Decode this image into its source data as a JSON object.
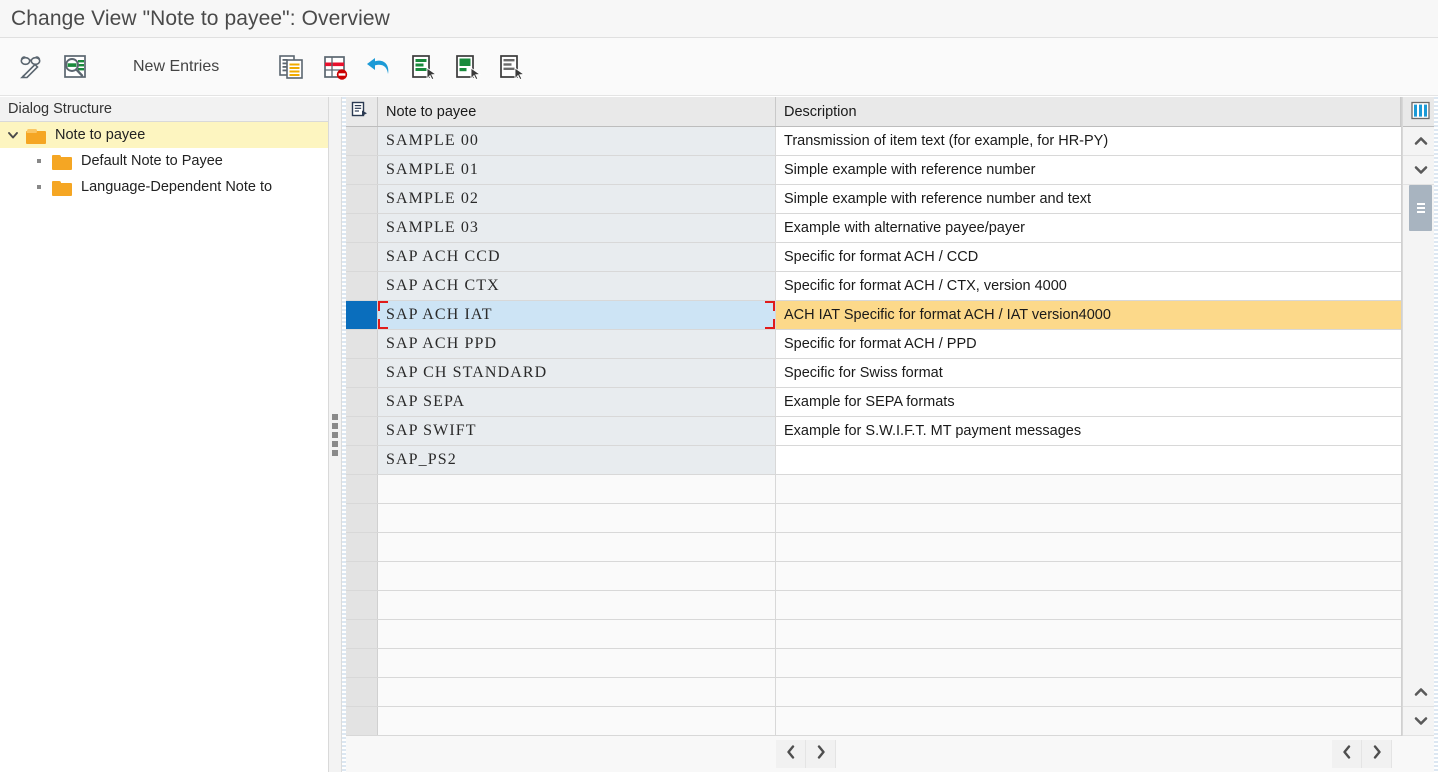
{
  "window": {
    "title": "Change View \"Note to payee\": Overview"
  },
  "toolbar": {
    "display_change_icon": "glasses-pencil-icon",
    "search_document_icon": "magnifier-document-icon",
    "new_entries_label": "New Entries",
    "copy_as_icon": "copy-as-icon",
    "delete_icon": "delete-row-icon",
    "undo_icon": "undo-icon",
    "select_all_icon": "select-all-icon",
    "select_block_icon": "select-block-icon",
    "deselect_all_icon": "deselect-all-icon"
  },
  "sidebar": {
    "header": "Dialog Structure",
    "items": [
      {
        "label": "Note to payee",
        "level": 0,
        "selected": true,
        "expanded": true,
        "icon": "folder-open-icon"
      },
      {
        "label": "Default Note to Payee",
        "level": 1,
        "selected": false,
        "expanded": false,
        "icon": "folder-icon"
      },
      {
        "label": "Language-Dependent Note to",
        "level": 1,
        "selected": false,
        "expanded": false,
        "icon": "folder-icon"
      }
    ]
  },
  "table": {
    "columns": [
      {
        "key": "marker",
        "label": "",
        "icon": "column-selector-icon"
      },
      {
        "key": "note_to_payee",
        "label": "Note to payee"
      },
      {
        "key": "description",
        "label": "Description"
      }
    ],
    "config_icon": "table-settings-icon",
    "rows": [
      {
        "note_to_payee": "SAMPLE 00",
        "description": "Transmission of item text (for example, for HR-PY)",
        "selected": false
      },
      {
        "note_to_payee": "SAMPLE 01",
        "description": "Simple example with reference number",
        "selected": false
      },
      {
        "note_to_payee": "SAMPLE 02",
        "description": "Simple example with reference number and text",
        "selected": false
      },
      {
        "note_to_payee": "SAMPLE 03",
        "description": "Example with alternative payee/payer",
        "selected": false
      },
      {
        "note_to_payee": "SAP ACH CCD",
        "description": "Specific for format ACH / CCD",
        "selected": false
      },
      {
        "note_to_payee": "SAP ACH CTX",
        "description": "Specific for format ACH / CTX, version 4000",
        "selected": false
      },
      {
        "note_to_payee": "SAP ACH IAT",
        "description": "ACH IAT Specific for format ACH / IAT version4000",
        "selected": true
      },
      {
        "note_to_payee": "SAP ACH PPD",
        "description": "Specific for format ACH / PPD",
        "selected": false
      },
      {
        "note_to_payee": "SAP CH STANDARD",
        "description": "Specific for Swiss format",
        "selected": false
      },
      {
        "note_to_payee": "SAP SEPA",
        "description": "Example for SEPA formats",
        "selected": false
      },
      {
        "note_to_payee": "SAP SWIFT",
        "description": "Example for S.W.I.F.T. MT payment messages",
        "selected": false
      },
      {
        "note_to_payee": "SAP_PS2",
        "description": "",
        "selected": false
      }
    ],
    "empty_row_count": 9
  },
  "scrollbars": {
    "vertical_up_icon": "chevron-up-icon",
    "vertical_down_icon": "chevron-down-icon",
    "thumb_grip_icon": "grip-lines-icon"
  },
  "bottom_bar": {
    "left_nav": [
      {
        "icon": "chevron-left-icon",
        "name": "page-previous-left"
      },
      {
        "icon": "chevron-right-icon",
        "name": "page-next-left"
      }
    ],
    "right_nav": [
      {
        "icon": "chevron-left-icon",
        "name": "page-previous-right"
      },
      {
        "icon": "chevron-right-icon",
        "name": "page-next-right"
      }
    ]
  },
  "colors": {
    "title_bar_bg": "#f7f7f7",
    "selection_marker": "#0a6ebd",
    "selected_key_cell": "#cde4f5",
    "selected_desc_cell": "#fcd98a",
    "selection_bracket": "#e01b1b",
    "tree_selected_bg": "#fdf5c0",
    "folder": "#f5a623"
  }
}
